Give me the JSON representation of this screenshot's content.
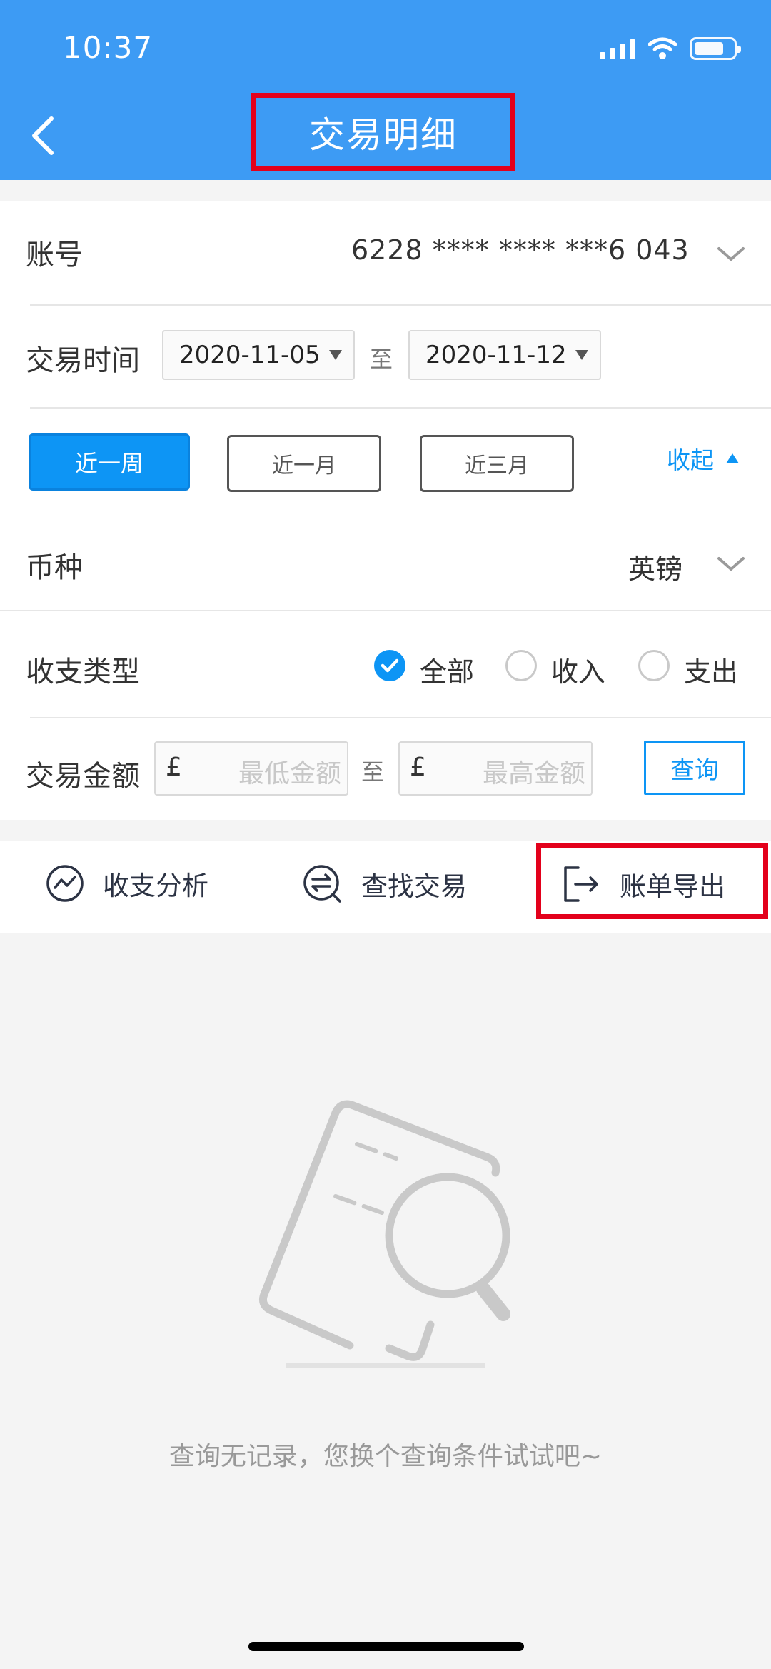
{
  "status_bar": {
    "time": "10:37"
  },
  "header": {
    "title": "交易明细"
  },
  "account": {
    "label": "账号",
    "value": "6228 **** **** ***6 043"
  },
  "time_range": {
    "label": "交易时间",
    "start": "2020-11-05",
    "separator": "至",
    "end": "2020-11-12"
  },
  "periods": [
    {
      "label": "近一周",
      "active": true
    },
    {
      "label": "近一月",
      "active": false
    },
    {
      "label": "近三月",
      "active": false
    }
  ],
  "collapse_label": "收起",
  "currency": {
    "label": "币种",
    "value": "英镑"
  },
  "txn_type": {
    "label": "收支类型",
    "options": [
      {
        "label": "全部",
        "checked": true
      },
      {
        "label": "收入",
        "checked": false
      },
      {
        "label": "支出",
        "checked": false
      }
    ]
  },
  "amount": {
    "label": "交易金额",
    "currency_symbol": "£",
    "min_placeholder": "最低金额",
    "separator": "至",
    "max_placeholder": "最高金额",
    "query_label": "查询"
  },
  "tools": [
    {
      "label": "收支分析",
      "icon": "trend-icon"
    },
    {
      "label": "查找交易",
      "icon": "swap-search-icon"
    },
    {
      "label": "账单导出",
      "icon": "export-icon"
    }
  ],
  "empty_state": {
    "message": "查询无记录，您换个查询条件试试吧~"
  },
  "colors": {
    "header": "#3d9bf4",
    "accent": "#0d95f5",
    "highlight": "#e3001b"
  }
}
